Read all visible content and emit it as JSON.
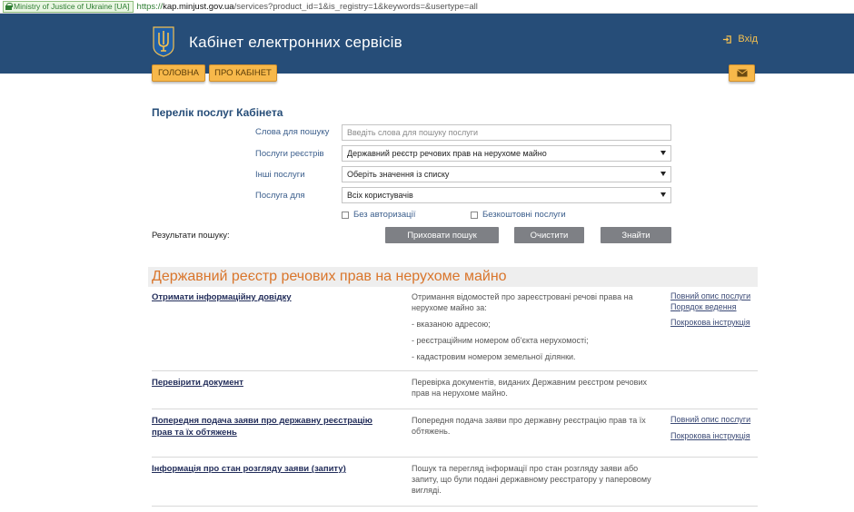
{
  "browser": {
    "ev_badge": "Ministry of Justice of Ukraine [UA]",
    "url_protocol": "https://",
    "url_host": "kap.minjust.gov.ua",
    "url_path": "/services?product_id=1&is_registry=1&keywords=&usertype=all"
  },
  "header": {
    "title": "Кабінет електронних сервісів",
    "login_label": "Вхід",
    "bg_color": "#264d78",
    "accent_color": "#f7b84a"
  },
  "nav": {
    "tabs": [
      {
        "label": "Головна"
      },
      {
        "label": "Про кабінет"
      }
    ],
    "mail_icon": "envelope-icon"
  },
  "search": {
    "section_title": "Перелік послуг Кабінета",
    "keywords": {
      "label": "Слова для пошуку",
      "placeholder": "Введіть слова для пошуку послуги",
      "value": ""
    },
    "registry": {
      "label": "Послуги реєстрів",
      "selected": "Державний реєстр речових прав на нерухоме майно"
    },
    "other": {
      "label": "Інші послуги",
      "selected": "Оберіть значення із списку"
    },
    "usertype": {
      "label": "Послуга для",
      "selected": "Всіх користувачів"
    },
    "no_auth_label": "Без авторизації",
    "free_label": "Безкоштовні послуги",
    "results_label": "Результати пошуку:",
    "buttons": {
      "hide": "Приховати пошук",
      "clear": "Очистити",
      "find": "Знайти"
    }
  },
  "registry": {
    "title": "Державний реєстр речових прав на нерухоме майно",
    "services": [
      {
        "name": "Отримати інформаційну довідку",
        "desc": [
          "Отримання відомостей про зареєстровані речові права на нерухоме майно за:",
          "- вказаною адресою;",
          "- реєстраційним номером об'єкта нерухомості;",
          "- кадастровим номером земельної ділянки."
        ],
        "links": [
          "Повний опис послуги",
          "Порядок ведення",
          "Покрокова інструкція"
        ]
      },
      {
        "name": "Перевірити документ",
        "desc": [
          "Перевірка документів, виданих Державним реєстром речових прав на нерухоме майно."
        ],
        "links": []
      },
      {
        "name": "Попередня подача заяви про державну реєстрацію прав та їх обтяжень",
        "desc": [
          "Попередня подача заяви про державну реєстрацію прав та їх обтяжень."
        ],
        "links": [
          "Повний опис послуги",
          "Покрокова інструкція"
        ]
      },
      {
        "name": "Інформація про стан розгляду заяви (запиту)",
        "desc": [
          "Пошук та перегляд інформації про стан розгляду заяви або запиту, що були подані державному реєстратору у паперовому вигляді."
        ],
        "links": []
      }
    ]
  }
}
